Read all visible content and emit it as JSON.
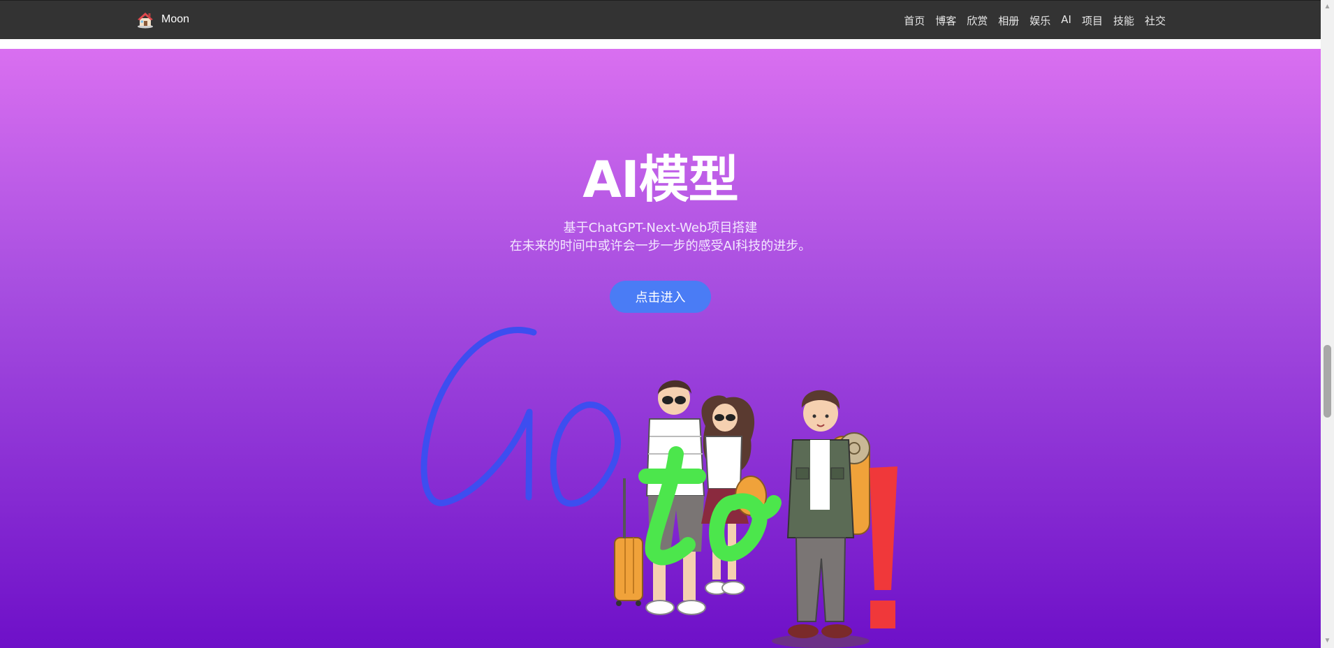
{
  "brand": {
    "name": "Moon",
    "logo_icon": "house-icon"
  },
  "nav": {
    "items": [
      {
        "label": "首页"
      },
      {
        "label": "博客"
      },
      {
        "label": "欣赏"
      },
      {
        "label": "相册"
      },
      {
        "label": "娱乐"
      },
      {
        "label": "AI"
      },
      {
        "label": "项目"
      },
      {
        "label": "技能"
      },
      {
        "label": "社交"
      }
    ]
  },
  "hero": {
    "title": "AI模型",
    "subtitle_line1": "基于ChatGPT-Next-Web项目搭建",
    "subtitle_line2": "在未来的时间中或许会一步一步的感受AI科技的进步。",
    "button_label": "点击进入",
    "illustration": {
      "word1": "Go",
      "word2": "to",
      "word3": "!"
    }
  },
  "colors": {
    "navbar_bg": "#333333",
    "gradient_top": "#d96ff0",
    "gradient_bottom": "#6e10c8",
    "button_bg": "#4a7cf5",
    "go_text": "#3d4ef0",
    "to_text": "#4ce64c",
    "exclaim_text": "#f0383a"
  }
}
